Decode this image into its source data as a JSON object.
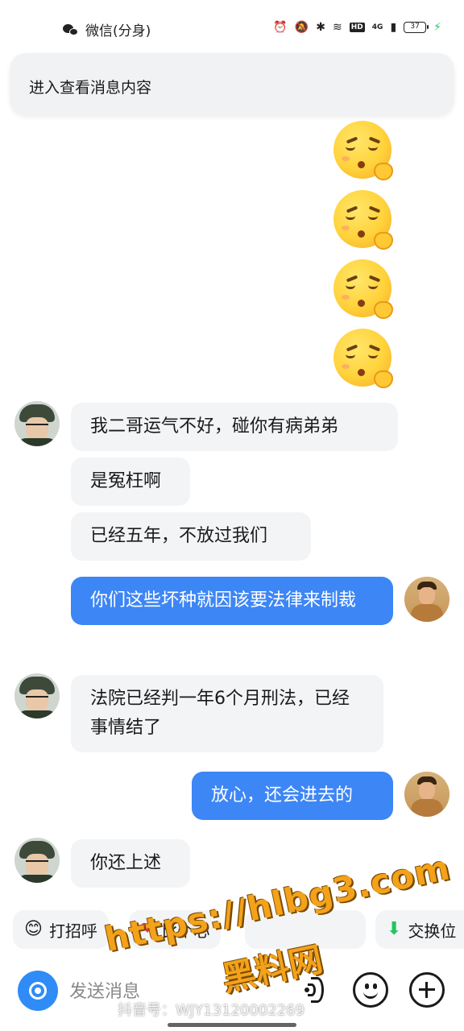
{
  "status_bar": {
    "app_name": "微信(分身)",
    "network": "4G",
    "hd": "HD",
    "battery": "37"
  },
  "banner": {
    "text": "进入查看消息内容"
  },
  "messages": [
    {
      "side": "out",
      "kind": "emoji",
      "emoji": "shushing-face-emoji"
    },
    {
      "side": "out",
      "kind": "emoji",
      "emoji": "shushing-face-emoji"
    },
    {
      "side": "out",
      "kind": "emoji",
      "emoji": "shushing-face-emoji"
    },
    {
      "side": "out",
      "kind": "emoji",
      "emoji": "shushing-face-emoji"
    },
    {
      "side": "in",
      "kind": "text",
      "text": "我二哥运气不好，碰你有病弟弟"
    },
    {
      "side": "in",
      "kind": "text",
      "text": "是冤枉啊"
    },
    {
      "side": "in",
      "kind": "text",
      "text": "已经五年，不放过我们"
    },
    {
      "side": "out",
      "kind": "text",
      "text": "你们这些坏种就因该要法律来制裁"
    },
    {
      "side": "in",
      "kind": "text",
      "text": "法院已经判一年6个月刑法，已经事情结了"
    },
    {
      "side": "out",
      "kind": "text",
      "text": "放心，还会进去的"
    },
    {
      "side": "in",
      "kind": "text",
      "text": "你还上述"
    }
  ],
  "quick_replies": [
    {
      "icon": "smile-icon",
      "label": "打招呼"
    },
    {
      "icon": "heart-icon",
      "label": "比个心"
    },
    {
      "icon": "hidden-icon",
      "label": ""
    },
    {
      "icon": "heart-icon",
      "label": ""
    },
    {
      "icon": "location-icon",
      "label": "交换位"
    }
  ],
  "input": {
    "placeholder": "发送消息"
  },
  "watermarks": {
    "url": "https://hlbg3.com",
    "brand": "黑料网",
    "douyin": "抖音号：WJY13120002269"
  },
  "colors": {
    "outgoing_bubble": "#3d86f5",
    "incoming_bubble": "#f3f4f6",
    "camera_button": "#2f8cf6"
  }
}
